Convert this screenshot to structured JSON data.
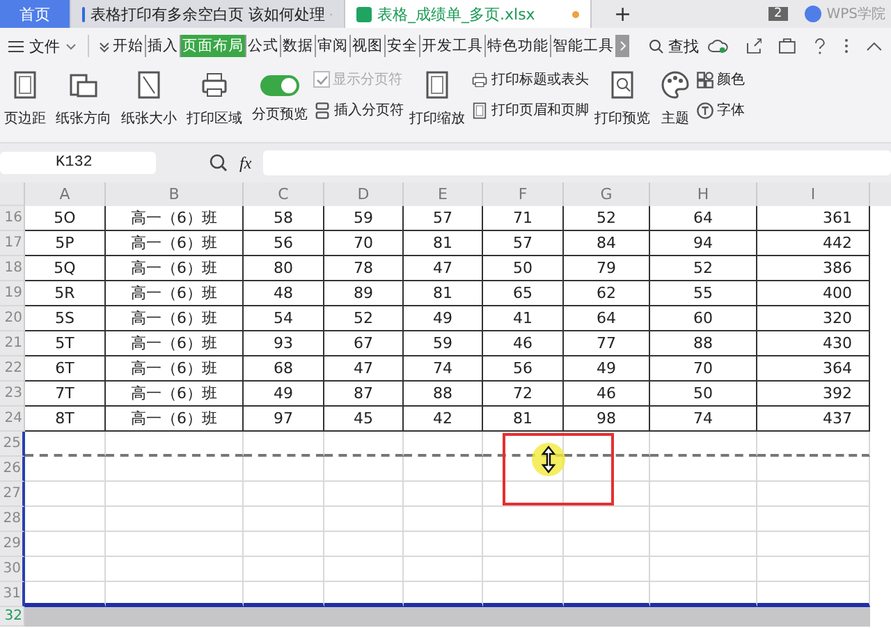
{
  "tabs": [
    {
      "label": "首页",
      "kind": "home",
      "selected": false
    },
    {
      "label": "表格打印有多余空白页 该如何处理",
      "kind": "doc",
      "selected": false
    },
    {
      "label": "表格_成绩单_多页.xlsx",
      "kind": "sheet",
      "selected": true
    }
  ],
  "tab_bar": {
    "new_tab": "+",
    "window_count": "2",
    "account": "WPS学院"
  },
  "menu": {
    "file": "文件",
    "items": [
      {
        "label": "开始",
        "selected": false
      },
      {
        "label": "插入",
        "selected": false
      },
      {
        "label": "页面布局",
        "selected": true
      },
      {
        "label": "公式",
        "selected": false
      },
      {
        "label": "数据",
        "selected": false
      },
      {
        "label": "审阅",
        "selected": false
      },
      {
        "label": "视图",
        "selected": false
      },
      {
        "label": "安全",
        "selected": false
      },
      {
        "label": "开发工具",
        "selected": false
      },
      {
        "label": "特色功能",
        "selected": false
      },
      {
        "label": "智能工具",
        "selected": false
      }
    ],
    "search": "查找"
  },
  "ribbon": [
    {
      "label": "页边距",
      "kind": "large"
    },
    {
      "label": "纸张方向",
      "kind": "large"
    },
    {
      "label": "纸张大小",
      "kind": "large"
    },
    {
      "label": "打印区域",
      "kind": "large"
    },
    {
      "label": "分页预览",
      "kind": "toggle",
      "on": true
    },
    {
      "kind": "stack",
      "items": [
        {
          "label": "显示分页符",
          "kind": "check",
          "checked": true,
          "disabled": true
        },
        {
          "label": "插入分页符",
          "kind": "small"
        }
      ]
    },
    {
      "label": "打印缩放",
      "kind": "large"
    },
    {
      "kind": "stack",
      "items": [
        {
          "label": "打印标题或表头",
          "kind": "small"
        },
        {
          "label": "打印页眉和页脚",
          "kind": "small"
        }
      ]
    },
    {
      "label": "打印预览",
      "kind": "large"
    },
    {
      "label": "主题",
      "kind": "large"
    },
    {
      "kind": "stack",
      "items": [
        {
          "label": "颜色",
          "kind": "small"
        },
        {
          "label": "字体",
          "kind": "small"
        }
      ]
    }
  ],
  "formula_bar": {
    "name_box": "K132",
    "fx": "fx"
  },
  "sheet": {
    "columns": [
      "A",
      "B",
      "C",
      "D",
      "E",
      "F",
      "G",
      "H",
      "I"
    ],
    "rows": [
      {
        "number": "16",
        "in_print_area": true,
        "page_break_after": false,
        "cells": [
          "5O",
          "高一（6）班",
          "58",
          "59",
          "57",
          "71",
          "52",
          "64",
          "361"
        ]
      },
      {
        "number": "17",
        "in_print_area": true,
        "page_break_after": false,
        "cells": [
          "5P",
          "高一（6）班",
          "56",
          "70",
          "81",
          "57",
          "84",
          "94",
          "442"
        ]
      },
      {
        "number": "18",
        "in_print_area": true,
        "page_break_after": false,
        "cells": [
          "5Q",
          "高一（6）班",
          "80",
          "78",
          "47",
          "50",
          "79",
          "52",
          "386"
        ]
      },
      {
        "number": "19",
        "in_print_area": true,
        "page_break_after": false,
        "cells": [
          "5R",
          "高一（6）班",
          "48",
          "89",
          "81",
          "65",
          "62",
          "55",
          "400"
        ]
      },
      {
        "number": "20",
        "in_print_area": true,
        "page_break_after": false,
        "cells": [
          "5S",
          "高一（6）班",
          "54",
          "52",
          "49",
          "41",
          "64",
          "60",
          "320"
        ]
      },
      {
        "number": "21",
        "in_print_area": true,
        "page_break_after": false,
        "cells": [
          "5T",
          "高一（6）班",
          "93",
          "67",
          "59",
          "46",
          "77",
          "88",
          "430"
        ]
      },
      {
        "number": "22",
        "in_print_area": true,
        "page_break_after": false,
        "cells": [
          "6T",
          "高一（6）班",
          "68",
          "47",
          "74",
          "56",
          "49",
          "70",
          "364"
        ]
      },
      {
        "number": "23",
        "in_print_area": true,
        "page_break_after": false,
        "cells": [
          "7T",
          "高一（6）班",
          "49",
          "87",
          "88",
          "72",
          "46",
          "50",
          "392"
        ]
      },
      {
        "number": "24",
        "in_print_area": true,
        "page_break_after": false,
        "cells": [
          "8T",
          "高一（6）班",
          "97",
          "45",
          "42",
          "81",
          "98",
          "74",
          "437"
        ]
      },
      {
        "number": "25",
        "in_print_area": true,
        "page_break_after": true
      },
      {
        "number": "26",
        "in_print_area": true,
        "page_break_after": false
      },
      {
        "number": "27",
        "in_print_area": true,
        "page_break_after": false
      },
      {
        "number": "28",
        "in_print_area": true,
        "page_break_after": false
      },
      {
        "number": "29",
        "in_print_area": true,
        "page_break_after": false
      },
      {
        "number": "30",
        "in_print_area": true,
        "page_break_after": false
      },
      {
        "number": "31",
        "in_print_area": true,
        "page_break_after": false
      },
      {
        "number": "32",
        "in_print_area": false,
        "page_break_after": false
      }
    ]
  }
}
